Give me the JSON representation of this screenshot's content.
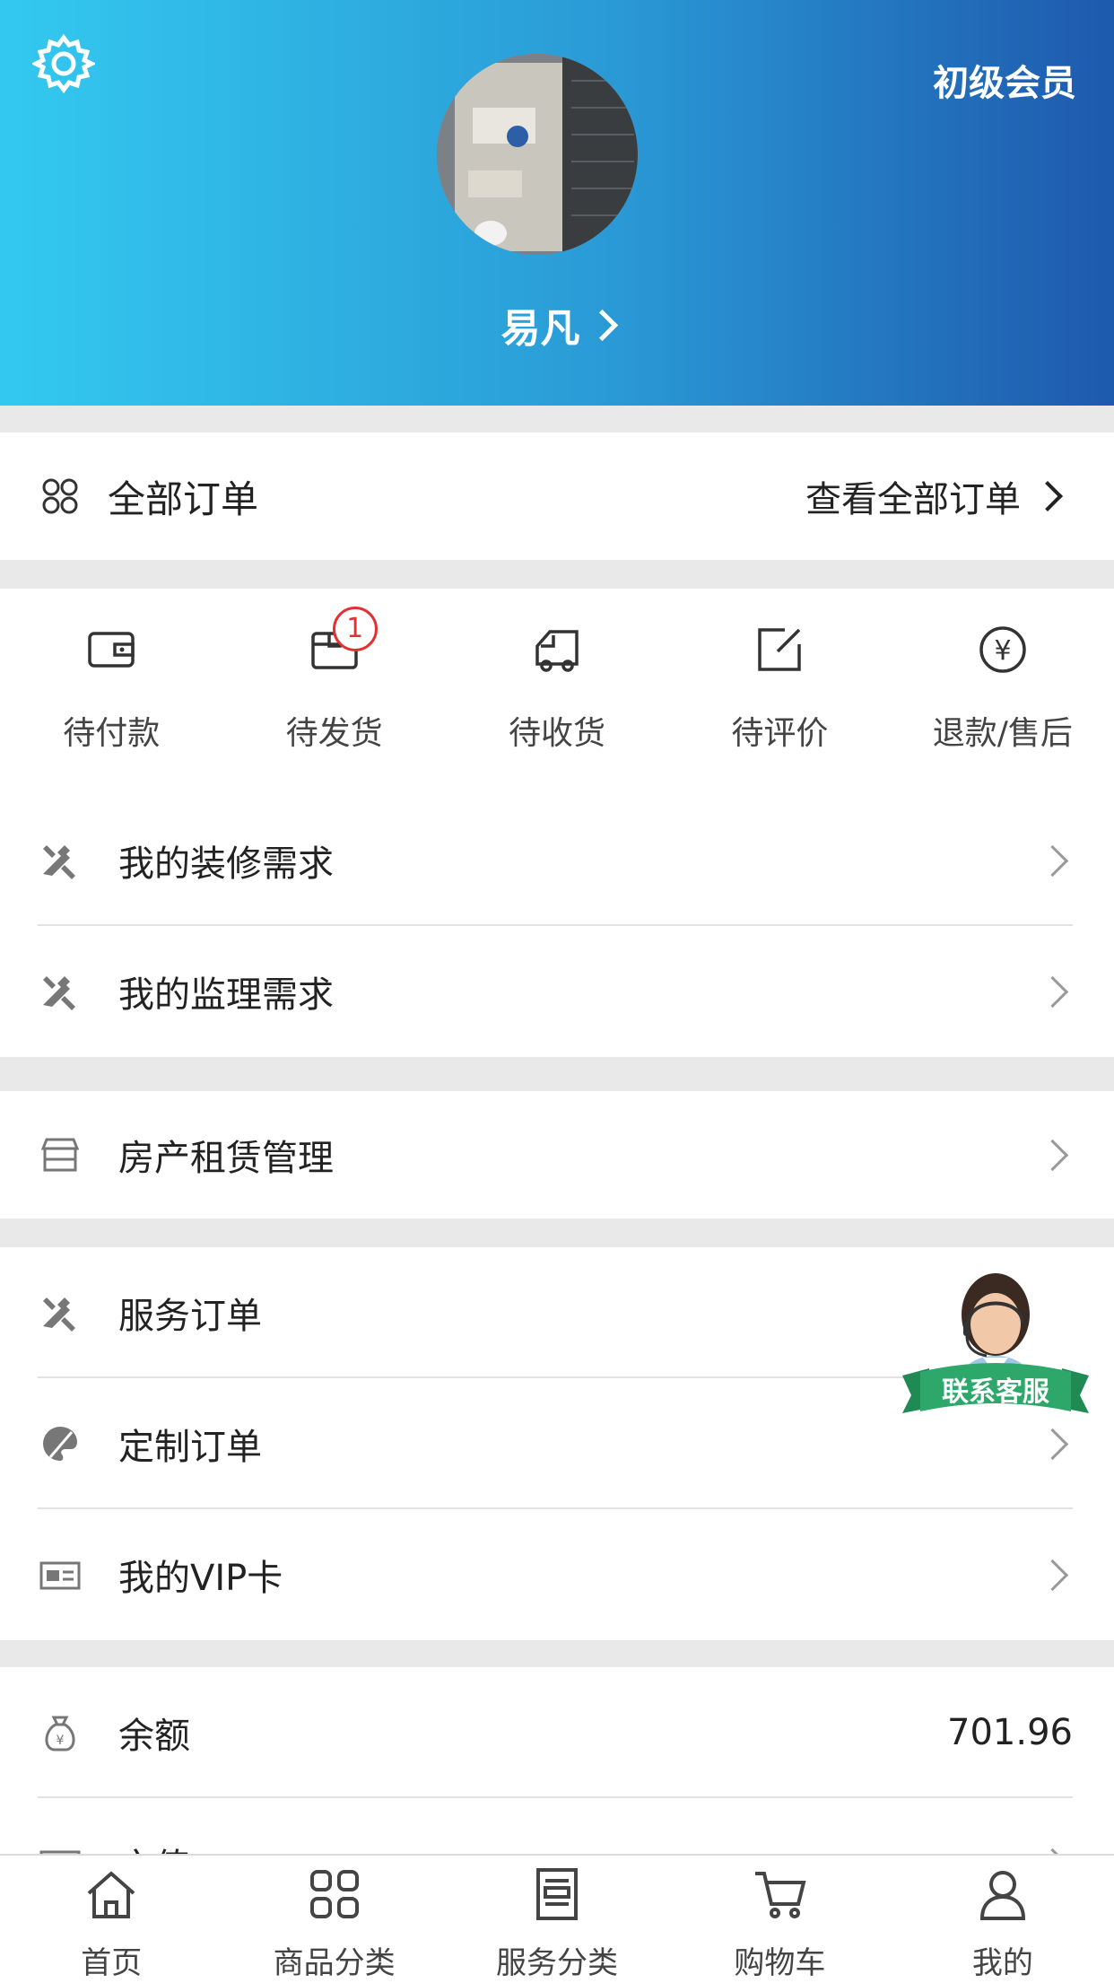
{
  "header": {
    "level": "初级会员",
    "username": "易凡"
  },
  "orders": {
    "title": "全部订单",
    "view_all": "查看全部订单",
    "statuses": [
      {
        "label": "待付款",
        "icon": "wallet-icon"
      },
      {
        "label": "待发货",
        "icon": "package-icon",
        "badge": "1"
      },
      {
        "label": "待收货",
        "icon": "truck-icon"
      },
      {
        "label": "待评价",
        "icon": "edit-icon"
      },
      {
        "label": "退款/售后",
        "icon": "yen-icon"
      }
    ]
  },
  "menu_group1": [
    {
      "label": "我的装修需求",
      "icon": "tools-icon"
    },
    {
      "label": "我的监理需求",
      "icon": "tools-icon"
    }
  ],
  "menu_group2": [
    {
      "label": "房产租赁管理",
      "icon": "storefront-icon"
    }
  ],
  "menu_group3": [
    {
      "label": "服务订单",
      "icon": "tools-icon"
    },
    {
      "label": "定制订单",
      "icon": "palette-icon"
    },
    {
      "label": "我的VIP卡",
      "icon": "card-icon"
    }
  ],
  "wallet": {
    "balance_label": "余额",
    "balance_value": "701.96",
    "next_label": "充值"
  },
  "customer_service": {
    "label": "联系客服"
  },
  "tabbar": [
    {
      "label": "首页",
      "icon": "home-icon"
    },
    {
      "label": "商品分类",
      "icon": "grid-icon"
    },
    {
      "label": "服务分类",
      "icon": "document-icon"
    },
    {
      "label": "购物车",
      "icon": "cart-icon"
    },
    {
      "label": "我的",
      "icon": "user-icon"
    }
  ],
  "colors": {
    "header_start": "#33c9ef",
    "header_end": "#1e59ad",
    "badge": "#e03232",
    "cs_ribbon": "#2ea86a"
  }
}
